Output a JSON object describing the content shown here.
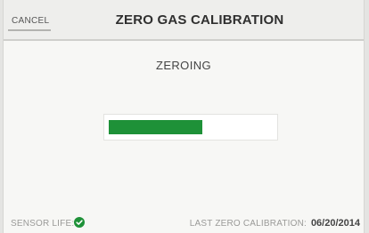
{
  "header": {
    "cancel_label": "CANCEL",
    "title": "ZERO GAS CALIBRATION"
  },
  "main": {
    "status": "ZEROING",
    "progress": 0.57,
    "progress_color": "#1e9138"
  },
  "footer": {
    "sensor_life_label": "SENSOR LIFE:",
    "sensor_life_icon": "check-circle-icon",
    "sensor_life_color": "#1e9138",
    "last_calibration_label": "LAST ZERO CALIBRATION:",
    "last_calibration_date": "06/20/2014"
  }
}
